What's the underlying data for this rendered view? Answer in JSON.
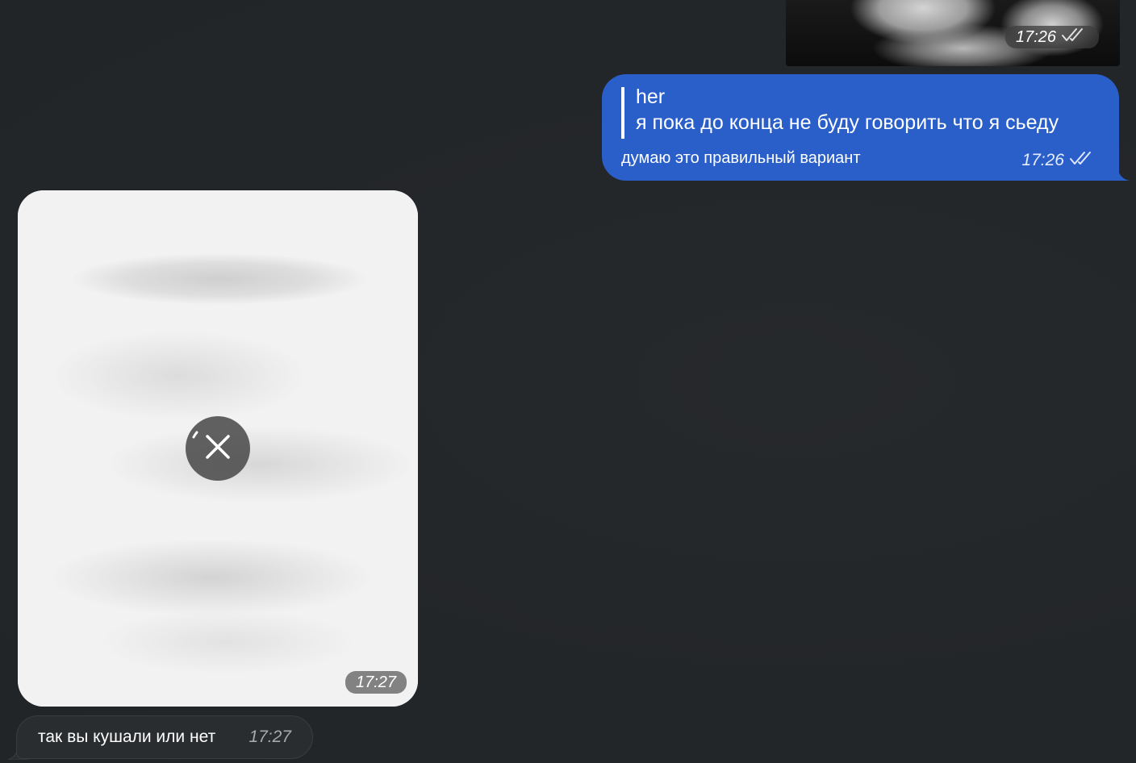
{
  "messages": {
    "top_media": {
      "time": "17:26",
      "status_icon": "double-check-icon"
    },
    "outgoing_reply": {
      "reply_name": "her",
      "reply_text": "я пока до конца не буду говорить что я сьеду",
      "text": "думаю это правильный вариант",
      "time": "17:26",
      "status_icon": "double-check-icon"
    },
    "incoming_media": {
      "time": "17:27",
      "action_icon": "cancel-download-icon"
    },
    "incoming_text": {
      "text": "так вы кушали или нет",
      "time": "17:27"
    }
  },
  "colors": {
    "background": "#24272a",
    "outgoing_bubble": "#2a5fc9",
    "incoming_bubble": "#2a2d30"
  }
}
